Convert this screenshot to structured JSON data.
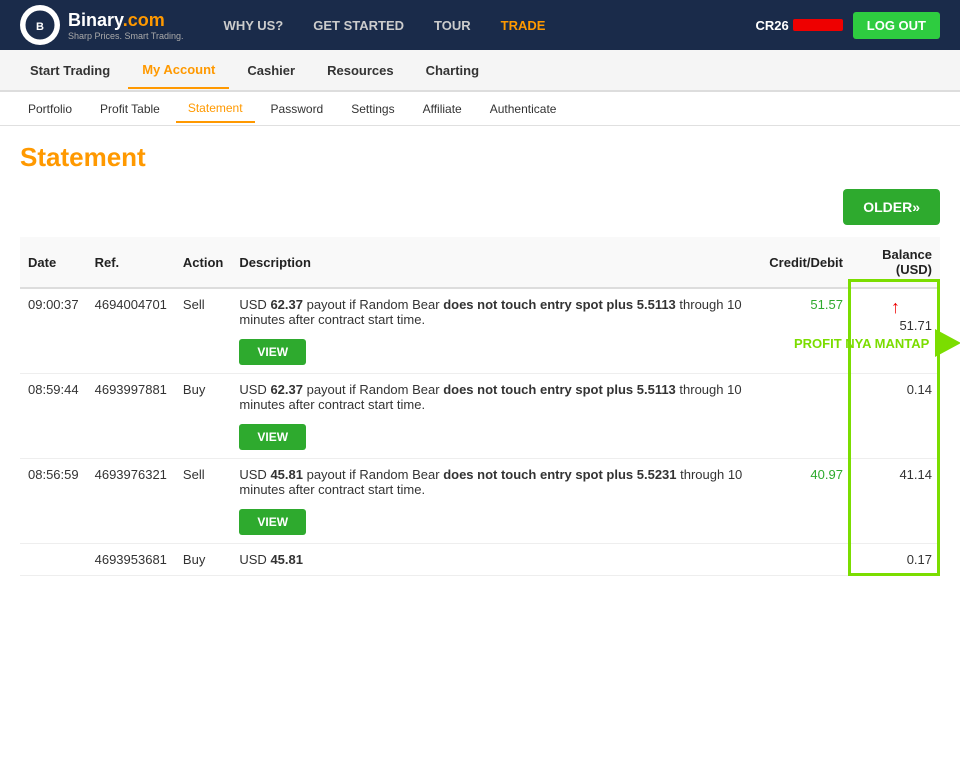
{
  "header": {
    "logo_brand": "Binary",
    "logo_tld": ".com",
    "logo_tagline": "Sharp Prices. Smart Trading.",
    "nav_items": [
      {
        "label": "WHY US?",
        "href": "#"
      },
      {
        "label": "GET STARTED",
        "href": "#"
      },
      {
        "label": "TOUR",
        "href": "#"
      },
      {
        "label": "TRADE",
        "href": "#",
        "class": "trade"
      }
    ],
    "account_id": "CR26",
    "logout_label": "LOG OUT"
  },
  "main_nav": {
    "items": [
      {
        "label": "Start Trading",
        "active": false
      },
      {
        "label": "My Account",
        "active": true
      },
      {
        "label": "Cashier",
        "active": false
      },
      {
        "label": "Resources",
        "active": false
      },
      {
        "label": "Charting",
        "active": false
      }
    ]
  },
  "sub_nav": {
    "items": [
      {
        "label": "Portfolio",
        "active": false
      },
      {
        "label": "Profit Table",
        "active": false
      },
      {
        "label": "Statement",
        "active": true
      },
      {
        "label": "Password",
        "active": false
      },
      {
        "label": "Settings",
        "active": false
      },
      {
        "label": "Affiliate",
        "active": false
      },
      {
        "label": "Authenticate",
        "active": false
      }
    ]
  },
  "page_title": "Statement",
  "older_button": "OLDER»",
  "table": {
    "columns": [
      "Date",
      "Ref.",
      "Action",
      "Description",
      "Credit/Debit",
      "Balance (USD)"
    ],
    "rows": [
      {
        "date": "09:00:37",
        "ref": "4694004701",
        "action": "Sell",
        "desc_prefix": "USD ",
        "desc_amount": "62.37",
        "desc_bold": " payout if Random Bear does not touch entry spot plus 5.5113",
        "desc_suffix": " through 10 minutes after contract start time.",
        "credit": "51.57",
        "balance": "51.71",
        "highlight": true,
        "annotation": "PROFIT NYA MANTAP"
      },
      {
        "date": "08:59:44",
        "ref": "4693997881",
        "action": "Buy",
        "desc_prefix": "USD ",
        "desc_amount": "62.37",
        "desc_bold": " payout if Random Bear does not touch entry spot plus 5.5113",
        "desc_suffix": " through 10 minutes after contract start time.",
        "credit": "",
        "balance": "0.14",
        "highlight": true
      },
      {
        "date": "08:56:59",
        "ref": "4693976321",
        "action": "Sell",
        "desc_prefix": "USD ",
        "desc_amount": "45.81",
        "desc_bold": " payout if Random Bear does not touch entry spot plus 5.5231",
        "desc_suffix": " through 10 minutes after contract start time.",
        "credit": "40.97",
        "balance": "41.14",
        "highlight": true
      },
      {
        "date": "",
        "ref": "4693953681",
        "action": "Buy",
        "desc_prefix": "USD ",
        "desc_amount": "45.81",
        "desc_bold": "",
        "desc_suffix": "",
        "credit": "",
        "balance": "0.17",
        "highlight": true,
        "partial": true
      }
    ]
  }
}
